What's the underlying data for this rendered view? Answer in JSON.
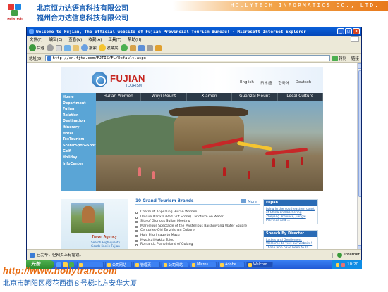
{
  "slide": {
    "company_cn_line1": "北京恒力达语言科技有限公司",
    "company_cn_line2": "福州合力达信息科技有限公司",
    "logo_text": "HollyTech",
    "banner_text": "HOLLYTECH INFORMATICS CO., LTD.",
    "footer_url": "http://www.hollytran.com",
    "footer_address": "北京市朝阳区樱花西街８号梯北方安华大厦"
  },
  "ie": {
    "title": "Welcome to Fujian, The official website of Fujian Provincial Tourism Bureau! - Microsoft Internet Explorer",
    "menu": [
      "文件(F)",
      "编辑(E)",
      "查看(V)",
      "收藏(A)",
      "工具(T)",
      "帮助(H)"
    ],
    "toolbar": {
      "back": "后退",
      "search": "搜索",
      "favorites": "收藏夹"
    },
    "address_label": "地址(D)",
    "address": "http://en.fjta.com/FJTIS/FL/Default.aspx",
    "go_label": "转到",
    "links_label": "链接",
    "status_text": "已完毕，但网页上有错误。",
    "zone_text": "Internet"
  },
  "site": {
    "brand_name": "FUJIAN",
    "brand_sub": "TOURISM",
    "languages": [
      "English",
      "日本語",
      "한국어",
      "Deutsch"
    ],
    "left_nav": [
      "Home",
      "Department",
      "Fujian",
      "Relation",
      "Destination",
      "Itinerary",
      "Hotel",
      "TeeTourism",
      "ScenicSpot&Spot",
      "Golf",
      "Holiday",
      "InfoCenter"
    ],
    "tabs": [
      "Hui'an Women",
      "Wuyi Mount",
      "Xiamen",
      "Guanzai Mount",
      "Local Culture"
    ],
    "travel_agency": "Travel Agency",
    "agency_sub_1": "Search High-quality",
    "agency_sub_2": "Goods line in Fujian",
    "brands_title": "10 Grand Tourism Brands",
    "more_label": "More",
    "brands": [
      "Charm of Appealing Hui'an Women",
      "Unique Danxia (Red Grit Stone) Landform on Water",
      "Site of Glorious Sulian Meeting",
      "Marvelous Spectacle of the Mysterious Baishuiyang Water Square",
      "Centuries-Old Tanzhishan Culture",
      "Holy Pilgrimage to Mazu",
      "Mystical Hakka Tulou",
      "Romantic Piano Island of Gulang"
    ],
    "panel_fujian_title": "Fujian",
    "panel_fujian_body": "Lying in the southeastern coast of China and bordering Zhejiang Province, Jiangxi Province and ...",
    "panel_speech_title": "Speech By Director",
    "panel_speech_body": "Ladies and Gentlemen: Welcome to visit our website! Those who have been to Ta..."
  },
  "taskbar": {
    "start": "开始",
    "tasks": [
      "",
      "公司网站",
      "管理页",
      "公司网站",
      "Micros...",
      "Adobe...",
      "Welcom..."
    ],
    "clock": "10:20"
  },
  "colors": {
    "brand_red": "#c6251f",
    "nav_blue": "#5aa5d6",
    "tab_dark": "#2c3a48",
    "link_blue": "#2a6bb5",
    "banner_orange": "#e8791b"
  }
}
